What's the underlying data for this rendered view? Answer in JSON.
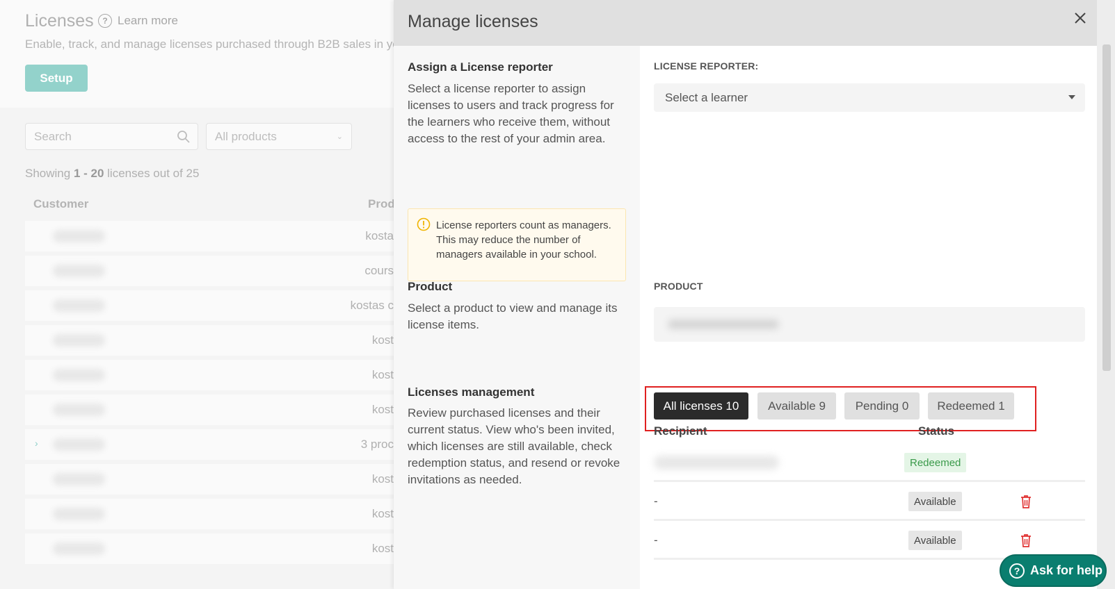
{
  "background": {
    "title": "Licenses",
    "learn_more": "Learn more",
    "subtitle": "Enable, track, and manage licenses purchased through B2B sales in yo",
    "setup_label": "Setup",
    "search_placeholder": "Search",
    "products_filter": "All products",
    "showing_prefix": "Showing ",
    "showing_range": "1 - 20",
    "showing_suffix": " licenses out of 25",
    "columns": {
      "customer": "Customer",
      "product": "Prod"
    },
    "rows": [
      {
        "product": "kosta"
      },
      {
        "product": "cours"
      },
      {
        "product": "kostas c"
      },
      {
        "product": "kost"
      },
      {
        "product": "kost"
      },
      {
        "product": "kost"
      },
      {
        "product": "3 proc"
      },
      {
        "product": "kost"
      },
      {
        "product": "kost"
      },
      {
        "product": "kost"
      }
    ]
  },
  "modal": {
    "title": "Manage licenses",
    "reporter_section": {
      "title": "Assign a License reporter",
      "description": "Select a license reporter to assign licenses to users and track progress for the learners who receive them, without access to the rest of your admin area.",
      "warning": "License reporters count as managers. This may reduce the number of managers available in your school.",
      "field_label": "LICENSE REPORTER:",
      "select_placeholder": "Select a learner"
    },
    "product_section": {
      "title": "Product",
      "description": "Select a product to view and manage its license items.",
      "field_label": "PRODUCT"
    },
    "licenses_section": {
      "title": "Licenses management",
      "description": "Review purchased licenses and their current status. View who's been invited, which licenses are still available, check redemption status, and resend or revoke invitations as needed.",
      "tabs": [
        {
          "label": "All licenses 10"
        },
        {
          "label": "Available 9"
        },
        {
          "label": "Pending 0"
        },
        {
          "label": "Redeemed 1"
        }
      ],
      "columns": {
        "recipient": "Recipient",
        "status": "Status"
      },
      "rows": [
        {
          "recipient": "",
          "status": "Redeemed"
        },
        {
          "recipient": "-",
          "status": "Available"
        },
        {
          "recipient": "-",
          "status": "Available"
        }
      ]
    }
  },
  "help_button": "Ask for help",
  "colors": {
    "accent": "#0a7e6f",
    "setup_button": "#93d2cb",
    "active_tab": "#2b2b2b",
    "highlight": "#e02020",
    "trash": "#e03030",
    "redeemed_badge": "#e4f5e6"
  }
}
